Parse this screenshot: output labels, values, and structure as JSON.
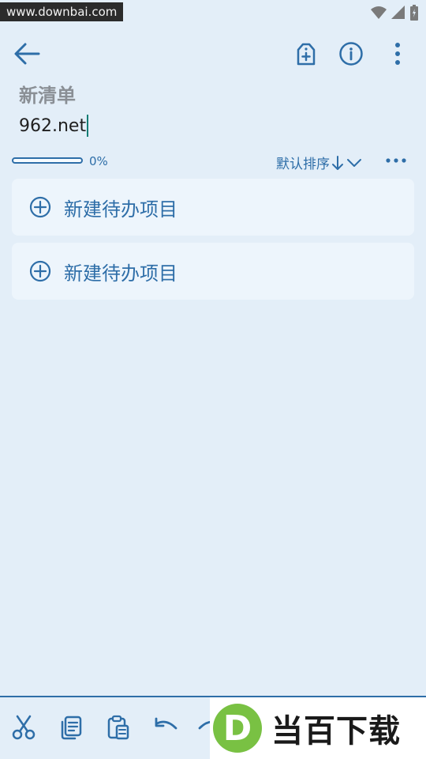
{
  "status_bar": {
    "watermark": "www.downbai.com",
    "icons": [
      "wifi-icon",
      "signal-icon",
      "battery-icon"
    ]
  },
  "toolbar": {
    "back_icon": "arrow-left-icon",
    "actions": [
      "tag-add-icon",
      "info-icon",
      "more-vertical-icon"
    ]
  },
  "list": {
    "title": "新清单",
    "subtitle": "962.net"
  },
  "progress": {
    "fraction": 0,
    "label": "0%"
  },
  "sort": {
    "label": "默认排序",
    "direction_icon": "arrow-down-icon",
    "dropdown_icon": "chevron-down-icon"
  },
  "items": [
    {
      "label": "新建待办项目",
      "icon": "plus-circle-icon"
    },
    {
      "label": "新建待办项目",
      "icon": "plus-circle-icon"
    }
  ],
  "bottom_bar": {
    "buttons": [
      "cut-icon",
      "copy-icon",
      "paste-icon",
      "undo-icon",
      "redo-icon"
    ]
  },
  "watermark_logo": {
    "letter": "D",
    "text": "当百下载"
  },
  "colors": {
    "accent": "#2e6ea8",
    "background": "#e3eef8",
    "card": "#edf5fc",
    "caret": "#0f7d74"
  }
}
